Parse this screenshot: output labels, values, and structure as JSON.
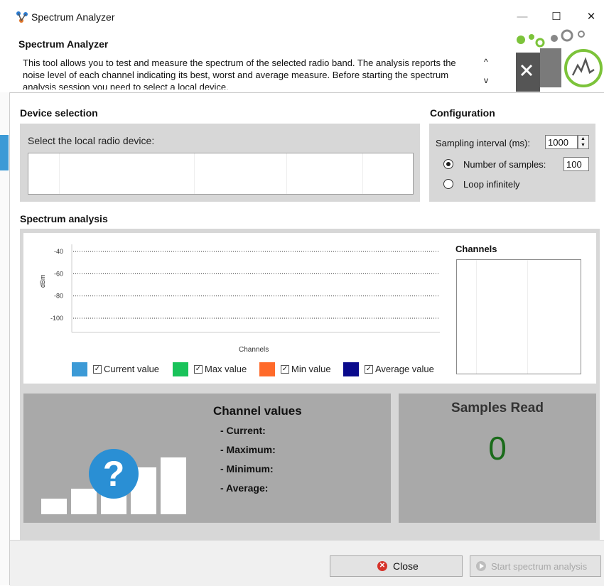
{
  "window": {
    "title": "Spectrum Analyzer",
    "minimize_glyph": "—",
    "maximize_glyph": "☐",
    "close_glyph": "✕"
  },
  "header": {
    "title": "Spectrum Analyzer",
    "description": "This tool allows you to test and measure the spectrum of the selected radio band. The analysis reports the noise level of each channel indicating its best, worst and average measure. Before starting the spectrum analysis session you need to select a local device.",
    "scroll_up": "^",
    "scroll_down": "v"
  },
  "device_selection": {
    "title": "Device selection",
    "label": "Select the local radio device:"
  },
  "configuration": {
    "title": "Configuration",
    "sampling_label": "Sampling interval (ms):",
    "sampling_value": "1000",
    "samples_label": "Number of samples:",
    "samples_value": "100",
    "loop_label": "Loop infinitely",
    "selected_mode": "samples"
  },
  "spectrum": {
    "title": "Spectrum analysis",
    "channels_title": "Channels"
  },
  "chart_data": {
    "type": "line",
    "xlabel": "Channels",
    "ylabel": "dBm",
    "yticks": [
      "-40",
      "-60",
      "-80",
      "-100"
    ],
    "ylim": [
      -110,
      -35
    ],
    "grid": "dotted",
    "series": [
      {
        "name": "Current value",
        "color": "#3c9ad6",
        "checked": true,
        "values": []
      },
      {
        "name": "Max value",
        "color": "#19c35a",
        "checked": true,
        "values": []
      },
      {
        "name": "Min value",
        "color": "#ff6a2a",
        "checked": true,
        "values": []
      },
      {
        "name": "Average value",
        "color": "#0a0a8c",
        "checked": true,
        "values": []
      }
    ],
    "legend": "bottom"
  },
  "channel_values": {
    "title": "Channel values",
    "current": "- Current:",
    "maximum": "- Maximum:",
    "minimum": "- Minimum:",
    "average": "- Average:",
    "icon_glyph": "?"
  },
  "samples_read": {
    "title": "Samples Read",
    "value": "0"
  },
  "buttons": {
    "close": "Close",
    "start": "Start spectrum analysis"
  }
}
